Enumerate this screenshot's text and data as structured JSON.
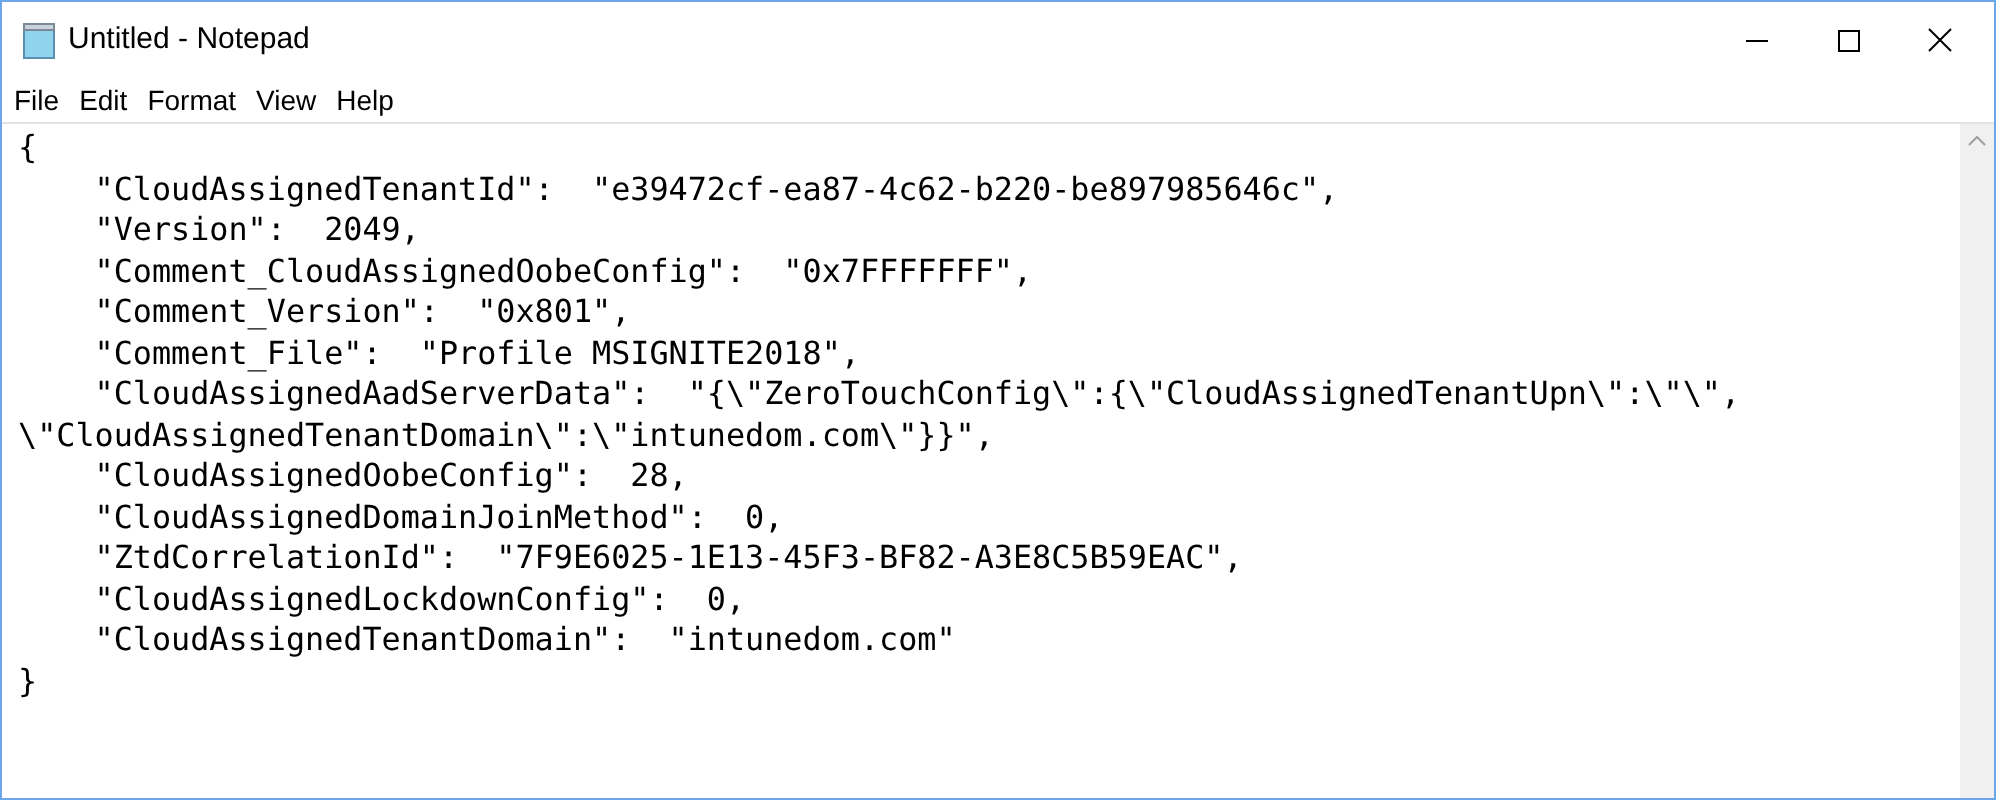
{
  "window": {
    "title": "Untitled - Notepad"
  },
  "menu": [
    "File",
    "Edit",
    "Format",
    "View",
    "Help"
  ],
  "editor": {
    "lines": [
      "{",
      "    \"CloudAssignedTenantId\":  \"e39472cf-ea87-4c62-b220-be897985646c\",",
      "    \"Version\":  2049,",
      "    \"Comment_CloudAssignedOobeConfig\":  \"0x7FFFFFFF\",",
      "    \"Comment_Version\":  \"0x801\",",
      "    \"Comment_File\":  \"Profile MSIGNITE2018\",",
      "    \"CloudAssignedAadServerData\":  \"{\\\"ZeroTouchConfig\\\":{\\\"CloudAssignedTenantUpn\\\":\\\"\\\",",
      "\\\"CloudAssignedTenantDomain\\\":\\\"intunedom.com\\\"}}\",",
      "    \"CloudAssignedOobeConfig\":  28,",
      "    \"CloudAssignedDomainJoinMethod\":  0,",
      "    \"ZtdCorrelationId\":  \"7F9E6025-1E13-45F3-BF82-A3E8C5B59EAC\",",
      "    \"CloudAssignedLockdownConfig\":  0,",
      "    \"CloudAssignedTenantDomain\":  \"intunedom.com\"",
      "}"
    ]
  }
}
